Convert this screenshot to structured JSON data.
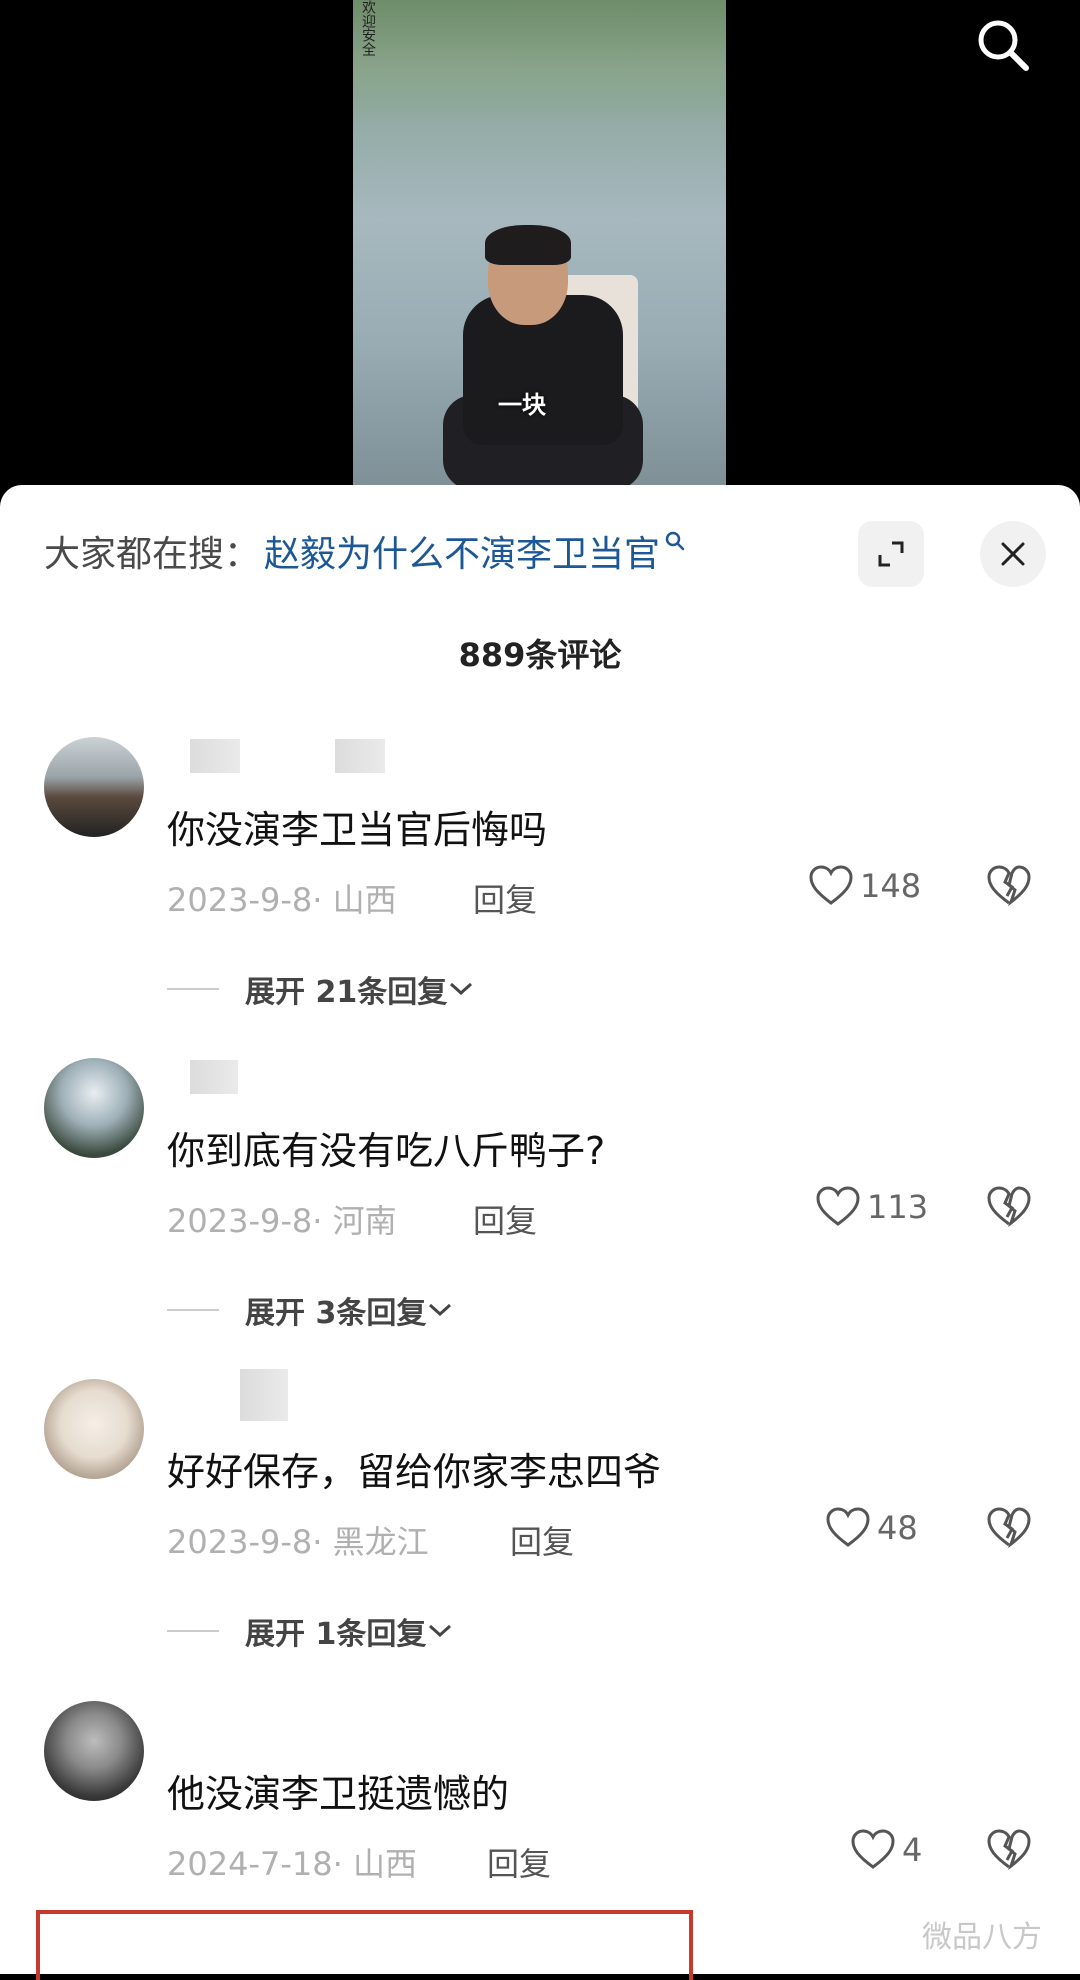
{
  "video": {
    "subtitle": "一块",
    "watermark_top": "欢迎安全"
  },
  "header": {
    "hot_search_prefix": "大家都在搜：",
    "hot_search_query": "赵毅为什么不演李卫当官"
  },
  "comment_count": "889条评论",
  "comments": [
    {
      "text": "你没演李卫当官后悔吗",
      "date": "2023-9-8",
      "region": "山西",
      "reply_label": "回复",
      "likes": "148",
      "expand_label": "展开 21条回复"
    },
    {
      "text": "你到底有没有吃八斤鸭子?",
      "date": "2023-9-8",
      "region": "河南",
      "reply_label": "回复",
      "likes": "113",
      "expand_label": "展开 3条回复"
    },
    {
      "text": "好好保存，留给你家李忠四爷",
      "date": "2023-9-8",
      "region": "黑龙江",
      "reply_label": "回复",
      "likes": "48",
      "expand_label": "展开 1条回复"
    },
    {
      "text": "他没演李卫挺遗憾的",
      "date": "2024-7-18",
      "region": "山西",
      "reply_label": "回复",
      "likes": "4"
    }
  ],
  "watermark": "微品八方",
  "colors": {
    "link": "#1d5896",
    "highlight_box": "#c63a2e",
    "meta": "#b0b0b0"
  }
}
